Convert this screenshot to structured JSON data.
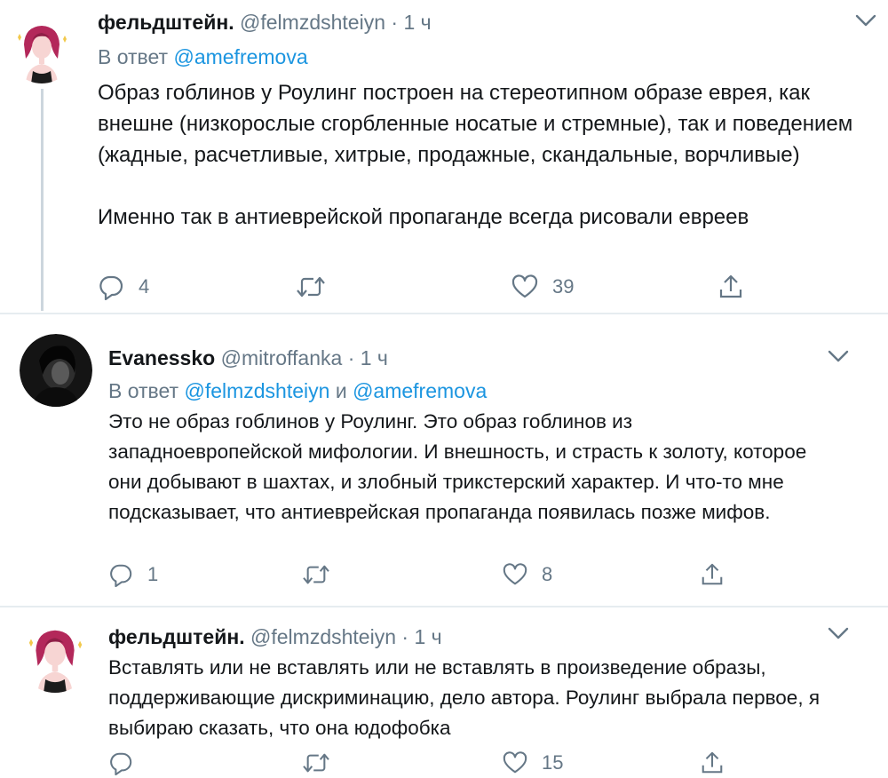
{
  "tweets": [
    {
      "name": "фельдштейн.",
      "handle": "@felmzdshteiyn",
      "dot": "·",
      "time": "1 ч",
      "reply_prefix": "В ответ",
      "reply_mentions": [
        "@amefremova"
      ],
      "paragraphs": [
        "Образ гоблинов у Роулинг построен на стереотипном образе еврея, как внешне (низкорослые сгорбленные носатые и стремные), так и поведением (жадные, расчетливые, хитрые, продажные, скандальные, ворчливые)",
        "Именно так в антиеврейской пропаганде всегда рисовали евреев"
      ],
      "replies": "4",
      "retweets": "",
      "likes": "39"
    },
    {
      "name": "Evanessko",
      "handle": "@mitroffanka",
      "dot": "·",
      "time": "1 ч",
      "reply_prefix": "В ответ",
      "reply_mentions": [
        "@felmzdshteiyn",
        "@amefremova"
      ],
      "reply_joiner": "и",
      "paragraphs": [
        "Это не образ гоблинов у Роулинг. Это образ гоблинов из западноевропейской мифологии. И внешность, и страсть к золоту, которое они добывают в шахтах, и злобный трикстерский характер. И что-то мне подсказывает, что антиеврейская пропаганда появилась позже мифов."
      ],
      "replies": "1",
      "retweets": "",
      "likes": "8"
    },
    {
      "name": "фельдштейн.",
      "handle": "@felmzdshteiyn",
      "dot": "·",
      "time": "1 ч",
      "paragraphs": [
        "Вставлять или не вставлять или не вставлять в произведение образы, поддерживающие дискриминацию, дело автора. Роулинг выбрала первое, я выбираю сказать, что она юдофобка"
      ],
      "replies": "",
      "retweets": "",
      "likes": "15"
    }
  ],
  "icons": {
    "reply": "reply-icon",
    "retweet": "retweet-icon",
    "like": "heart-icon",
    "share": "share-icon",
    "menu": "chevron-down-icon"
  },
  "colors": {
    "text": "#14171a",
    "secondary": "#657786",
    "link": "#1b95e0",
    "thread_line": "#ccd6dd",
    "separator": "#e6ecf0"
  }
}
